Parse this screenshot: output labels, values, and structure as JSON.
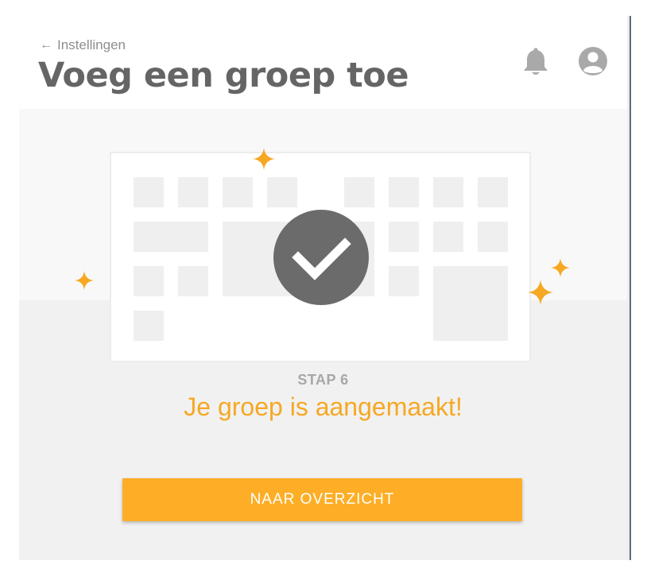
{
  "header": {
    "back_label": "Instellingen",
    "title": "Voeg een groep toe",
    "icons": [
      "back-arrow-icon",
      "bell-icon",
      "user-avatar-icon"
    ]
  },
  "confirmation": {
    "step_label": "STAP 6",
    "message": "Je groep is aangemaakt!",
    "icon": "checkmark-icon",
    "decorations": [
      "sparkle-icon"
    ]
  },
  "actions": {
    "primary_label": "NAAR OVERZICHT"
  },
  "colors": {
    "accent": "#fdae26",
    "message": "#f6a823",
    "title": "#656565",
    "icon_gray": "#a9a9a9",
    "check_circle": "#6b6b6b"
  }
}
